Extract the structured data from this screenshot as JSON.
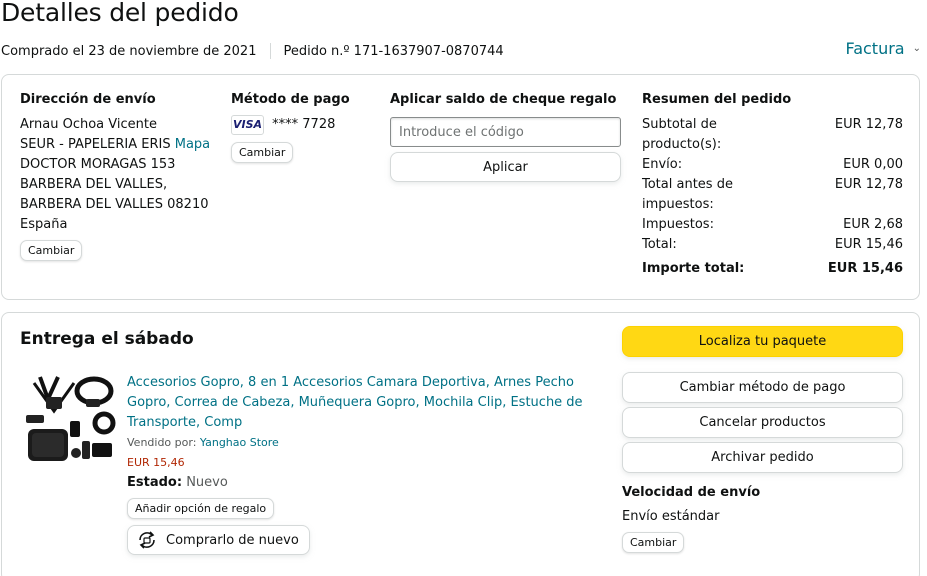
{
  "header": {
    "title": "Detalles del pedido",
    "purchased": "Comprado el 23 de noviembre de 2021",
    "order_number": "Pedido n.º 171-1637907-0870744",
    "invoice_label": "Factura"
  },
  "shipping": {
    "title": "Dirección de envío",
    "name": "Arnau Ochoa Vicente",
    "company": "SEUR - PAPELERIA ERIS",
    "map_link": "Mapa",
    "street": "DOCTOR MORAGAS 153",
    "city1": "BARBERA DEL VALLES,",
    "city2": "BARBERA DEL VALLES 08210",
    "country": "España",
    "change_label": "Cambiar"
  },
  "payment": {
    "title": "Método de pago",
    "card_brand": "VISA",
    "card_number": "**** 7728",
    "change_label": "Cambiar"
  },
  "gift_card": {
    "title": "Aplicar saldo de cheque regalo",
    "placeholder": "Introduce el código",
    "value": "",
    "apply_label": "Aplicar"
  },
  "summary": {
    "title": "Resumen del pedido",
    "rows": [
      {
        "label": "Subtotal de producto(s):",
        "value": "EUR 12,78"
      },
      {
        "label": "Envío:",
        "value": "EUR 0,00"
      },
      {
        "label": "Total antes de impuestos:",
        "value": "EUR 12,78"
      },
      {
        "label": "Impuestos:",
        "value": "EUR 2,68"
      },
      {
        "label": "Total:",
        "value": "EUR 15,46"
      }
    ],
    "grand_total_label": "Importe total:",
    "grand_total_value": "EUR 15,46"
  },
  "delivery": {
    "title": "Entrega el sábado",
    "product": {
      "title": "Accesorios Gopro, 8 en 1 Accesorios Camara Deportiva, Arnes Pecho Gopro, Correa de Cabeza, Muñequera Gopro, Mochila Clip, Estuche de Transporte, Comp",
      "seller_prefix": "Vendido por:",
      "seller": "Yanghao Store",
      "price": "EUR 15,46",
      "state_label": "Estado:",
      "state_value": "Nuevo",
      "gift_option_label": "Añadir opción de regalo",
      "buy_again_label": "Comprarlo de nuevo"
    },
    "actions": {
      "track": "Localiza tu paquete",
      "change_payment": "Cambiar método de pago",
      "cancel": "Cancelar productos",
      "archive": "Archivar pedido"
    },
    "speed": {
      "title": "Velocidad de envío",
      "value": "Envío estándar",
      "change_label": "Cambiar"
    }
  },
  "colors": {
    "link": "#007185",
    "primary_button": "#ffd814",
    "price": "#b12704",
    "border": "#d5d9d9"
  }
}
